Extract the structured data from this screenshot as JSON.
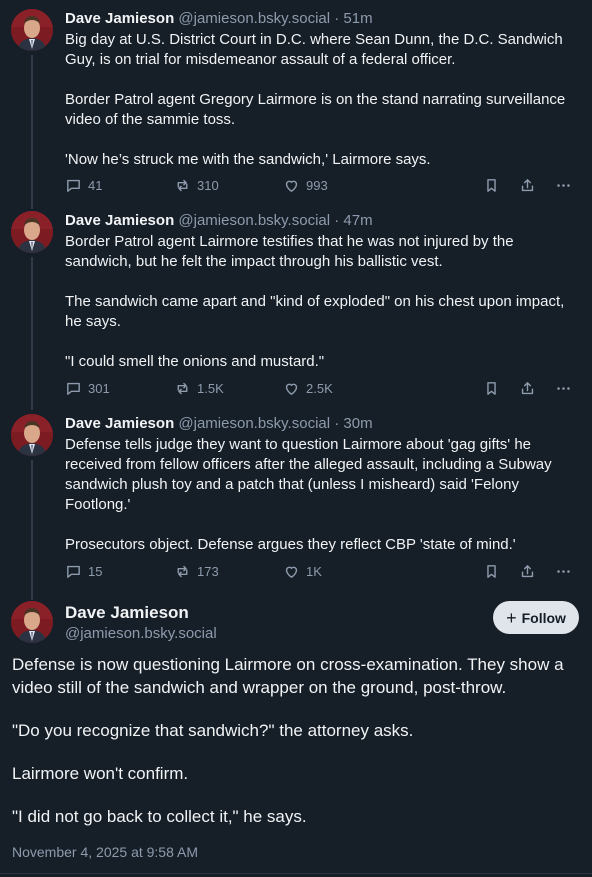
{
  "posts": [
    {
      "name": "Dave Jamieson",
      "handle": "@jamieson.bsky.social",
      "separator": "·",
      "time": "51m",
      "paragraphs": [
        "Big day at U.S. District Court in D.C. where Sean Dunn, the D.C. Sandwich Guy, is on trial for misdemeanor assault of a federal officer.",
        "Border Patrol agent Gregory Lairmore is on the stand narrating surveillance video of the sammie toss.",
        "'Now he’s struck me with the sandwich,' Lairmore says."
      ],
      "replies": "41",
      "reposts": "310",
      "likes": "993"
    },
    {
      "name": "Dave Jamieson",
      "handle": "@jamieson.bsky.social",
      "separator": "·",
      "time": "47m",
      "paragraphs": [
        "Border Patrol agent Lairmore testifies that he was not injured by the sandwich, but he felt the impact through his ballistic vest.",
        "The sandwich came apart and \"kind of exploded\" on his chest upon impact, he says.",
        "\"I could smell the onions and mustard.\""
      ],
      "replies": "301",
      "reposts": "1.5K",
      "likes": "2.5K"
    },
    {
      "name": "Dave Jamieson",
      "handle": "@jamieson.bsky.social",
      "separator": "·",
      "time": "30m",
      "paragraphs": [
        "Defense tells judge they want to question Lairmore about 'gag gifts' he received from fellow officers after the alleged assault, including a Subway sandwich plush toy and a patch that (unless I misheard) said 'Felony Footlong.'",
        "Prosecutors object. Defense argues they reflect CBP 'state of mind.'"
      ],
      "replies": "15",
      "reposts": "173",
      "likes": "1K"
    }
  ],
  "main_post": {
    "name": "Dave Jamieson",
    "handle": "@jamieson.bsky.social",
    "follow_label": "Follow",
    "follow_plus": "+",
    "paragraphs": [
      "Defense is now questioning Lairmore on cross-examination. They show a video still of the sandwich and wrapper on the ground, post-throw.",
      "\"Do you recognize that sandwich?\" the attorney asks.",
      "Lairmore won't confirm.",
      "\"I did not go back to collect it,\" he says."
    ],
    "date": "November 4, 2025 at 9:58 AM"
  },
  "icons": {
    "reply": "speech-bubble-icon",
    "repost": "repost-arrows-icon",
    "like": "heart-outline-icon",
    "bookmark": "bookmark-icon",
    "share": "share-upload-icon",
    "more": "ellipsis-icon"
  },
  "colors": {
    "background": "#161e27",
    "text": "#f1f3f5",
    "muted": "#8d9bad",
    "follow_button": "#e0e5eb"
  }
}
